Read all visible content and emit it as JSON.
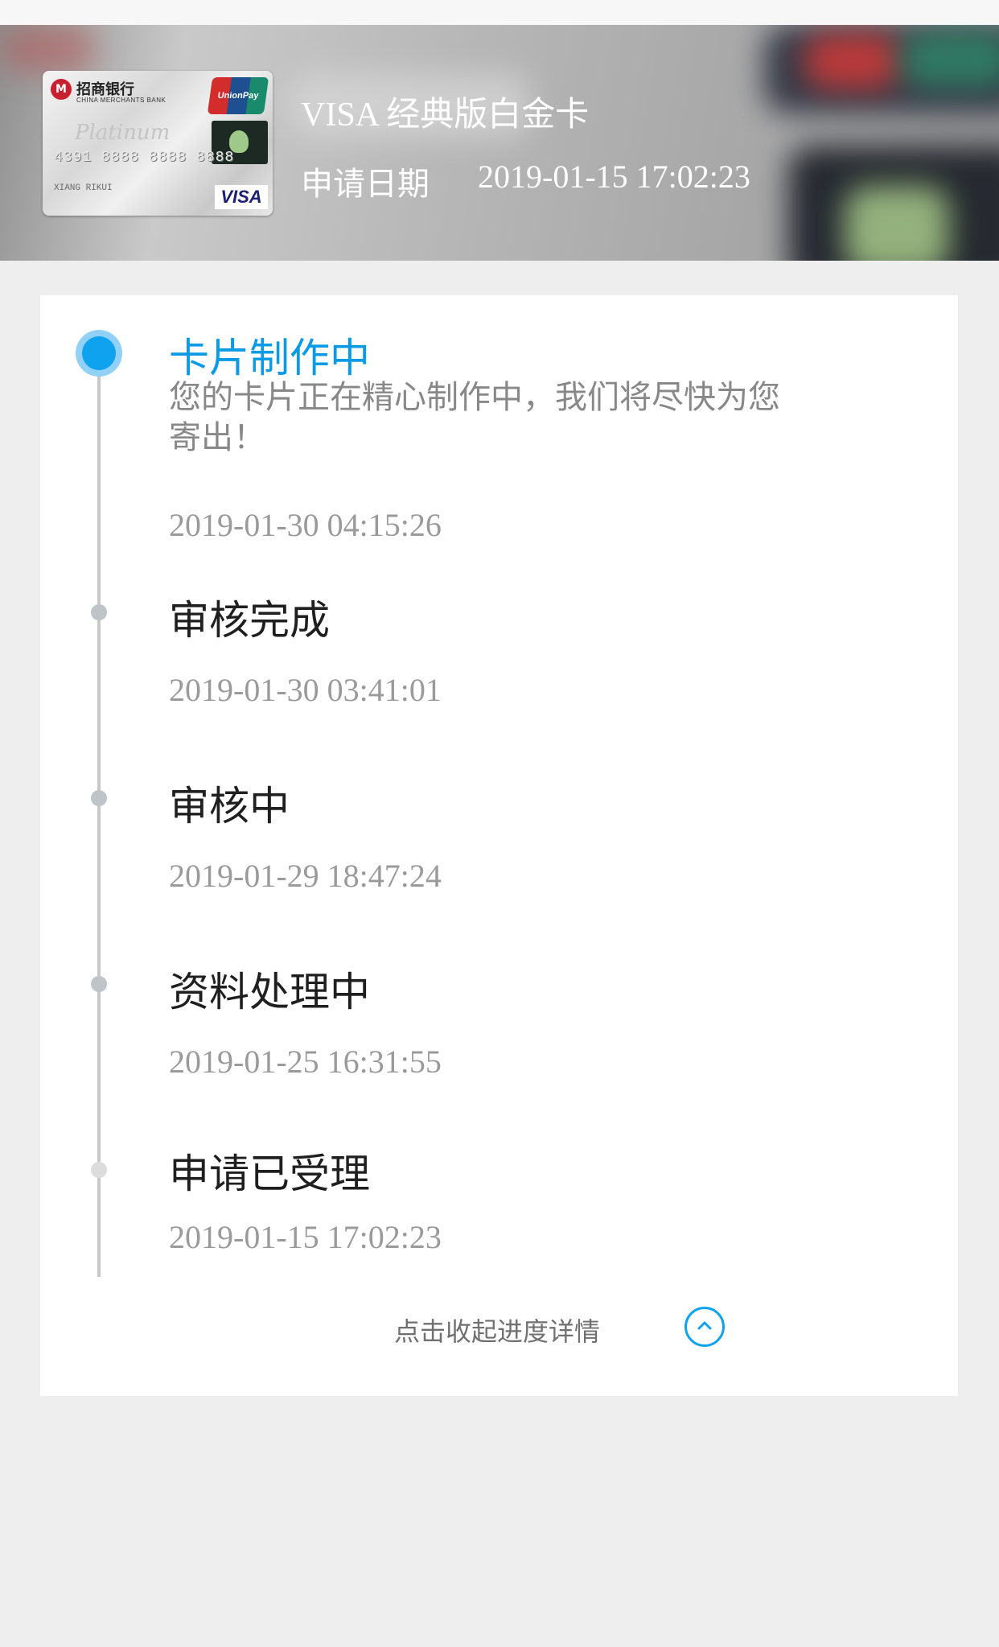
{
  "card": {
    "name": "VISA 经典版白金卡",
    "apply_label": "申请日期",
    "apply_date": "2019-01-15 17:02:23",
    "image": {
      "bank_name": "招商银行",
      "bank_name_en": "CHINA MERCHANTS BANK",
      "tier": "Platinum",
      "number": "4391 8888 8888 8888",
      "holder": "XIANG RIKUI",
      "network_brand": "VISA",
      "unionpay": "UnionPay"
    }
  },
  "progress": {
    "steps": [
      {
        "title": "卡片制作中",
        "description": "您的卡片正在精心制作中，我们将尽快为您寄出！",
        "time": "2019-01-30 04:15:26",
        "active": true
      },
      {
        "title": "审核完成",
        "time": "2019-01-30 03:41:01",
        "active": false
      },
      {
        "title": "审核中",
        "time": "2019-01-29 18:47:24",
        "active": false
      },
      {
        "title": "资料处理中",
        "time": "2019-01-25 16:31:55",
        "active": false
      },
      {
        "title": "申请已受理",
        "time": "2019-01-15 17:02:23",
        "active": false
      }
    ],
    "collapse_label": "点击收起进度详情"
  },
  "colors": {
    "accent": "#0ea2ef",
    "background": "#eeeeee",
    "panel": "#ffffff",
    "timeline": "#c8c8c8"
  },
  "icons": {
    "collapse": "chevron-up-circle-icon"
  }
}
